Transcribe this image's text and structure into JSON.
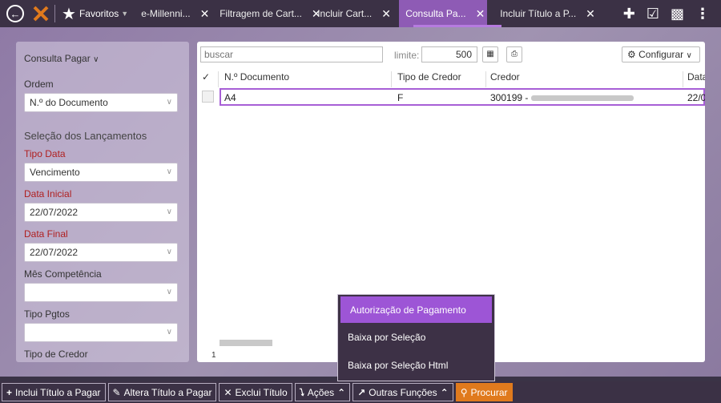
{
  "topbar": {
    "favorites_label": "Favoritos",
    "tabs": [
      {
        "label": "e-Millenni...",
        "active": false
      },
      {
        "label": "Filtragem de Cart...",
        "active": false
      },
      {
        "label": "Incluir Cart...",
        "active": false
      },
      {
        "label": "Consulta Pa...",
        "active": true
      },
      {
        "label": "Incluir Título a P...",
        "active": false
      }
    ],
    "colors": {
      "bar": "#3b3145",
      "active_tab": "#8e5bb5",
      "accent": "#e07a1d"
    }
  },
  "filters": {
    "title": "Consulta Pagar",
    "ordem_label": "Ordem",
    "ordem_value": "N.º do Documento",
    "section_title": "Seleção dos Lançamentos",
    "tipo_data_label": "Tipo Data",
    "tipo_data_value": "Vencimento",
    "data_inicial_label": "Data Inicial",
    "data_inicial_value": "22/07/2022",
    "data_final_label": "Data Final",
    "data_final_value": "22/07/2022",
    "mes_competencia_label": "Mês Competência",
    "mes_competencia_value": "",
    "tipo_pgtos_label": "Tipo Pgtos",
    "tipo_pgtos_value": "",
    "tipo_credor_label": "Tipo de Credor"
  },
  "grid": {
    "search_placeholder": "buscar",
    "limite_label": "limite:",
    "limite_value": "500",
    "configurar_label": "Configurar",
    "columns": [
      "N.º Documento",
      "Tipo de Credor",
      "Credor",
      "Data"
    ],
    "rows": [
      {
        "documento": "A4",
        "tipo_credor": "F",
        "credor": "300199 -",
        "data": "22/0"
      }
    ],
    "page": "1"
  },
  "dropdown": {
    "items": [
      {
        "label": "Autorização de Pagamento",
        "selected": true
      },
      {
        "label": "Baixa por Seleção",
        "selected": false
      },
      {
        "label": "Baixa por Seleção Html",
        "selected": false
      }
    ]
  },
  "bottombar": {
    "incluir": "Inclui Título a Pagar",
    "alterar": "Altera Título a Pagar",
    "excluir": "Exclui Título",
    "acoes": "Ações",
    "outras": "Outras Funções",
    "procurar": "Procurar"
  }
}
